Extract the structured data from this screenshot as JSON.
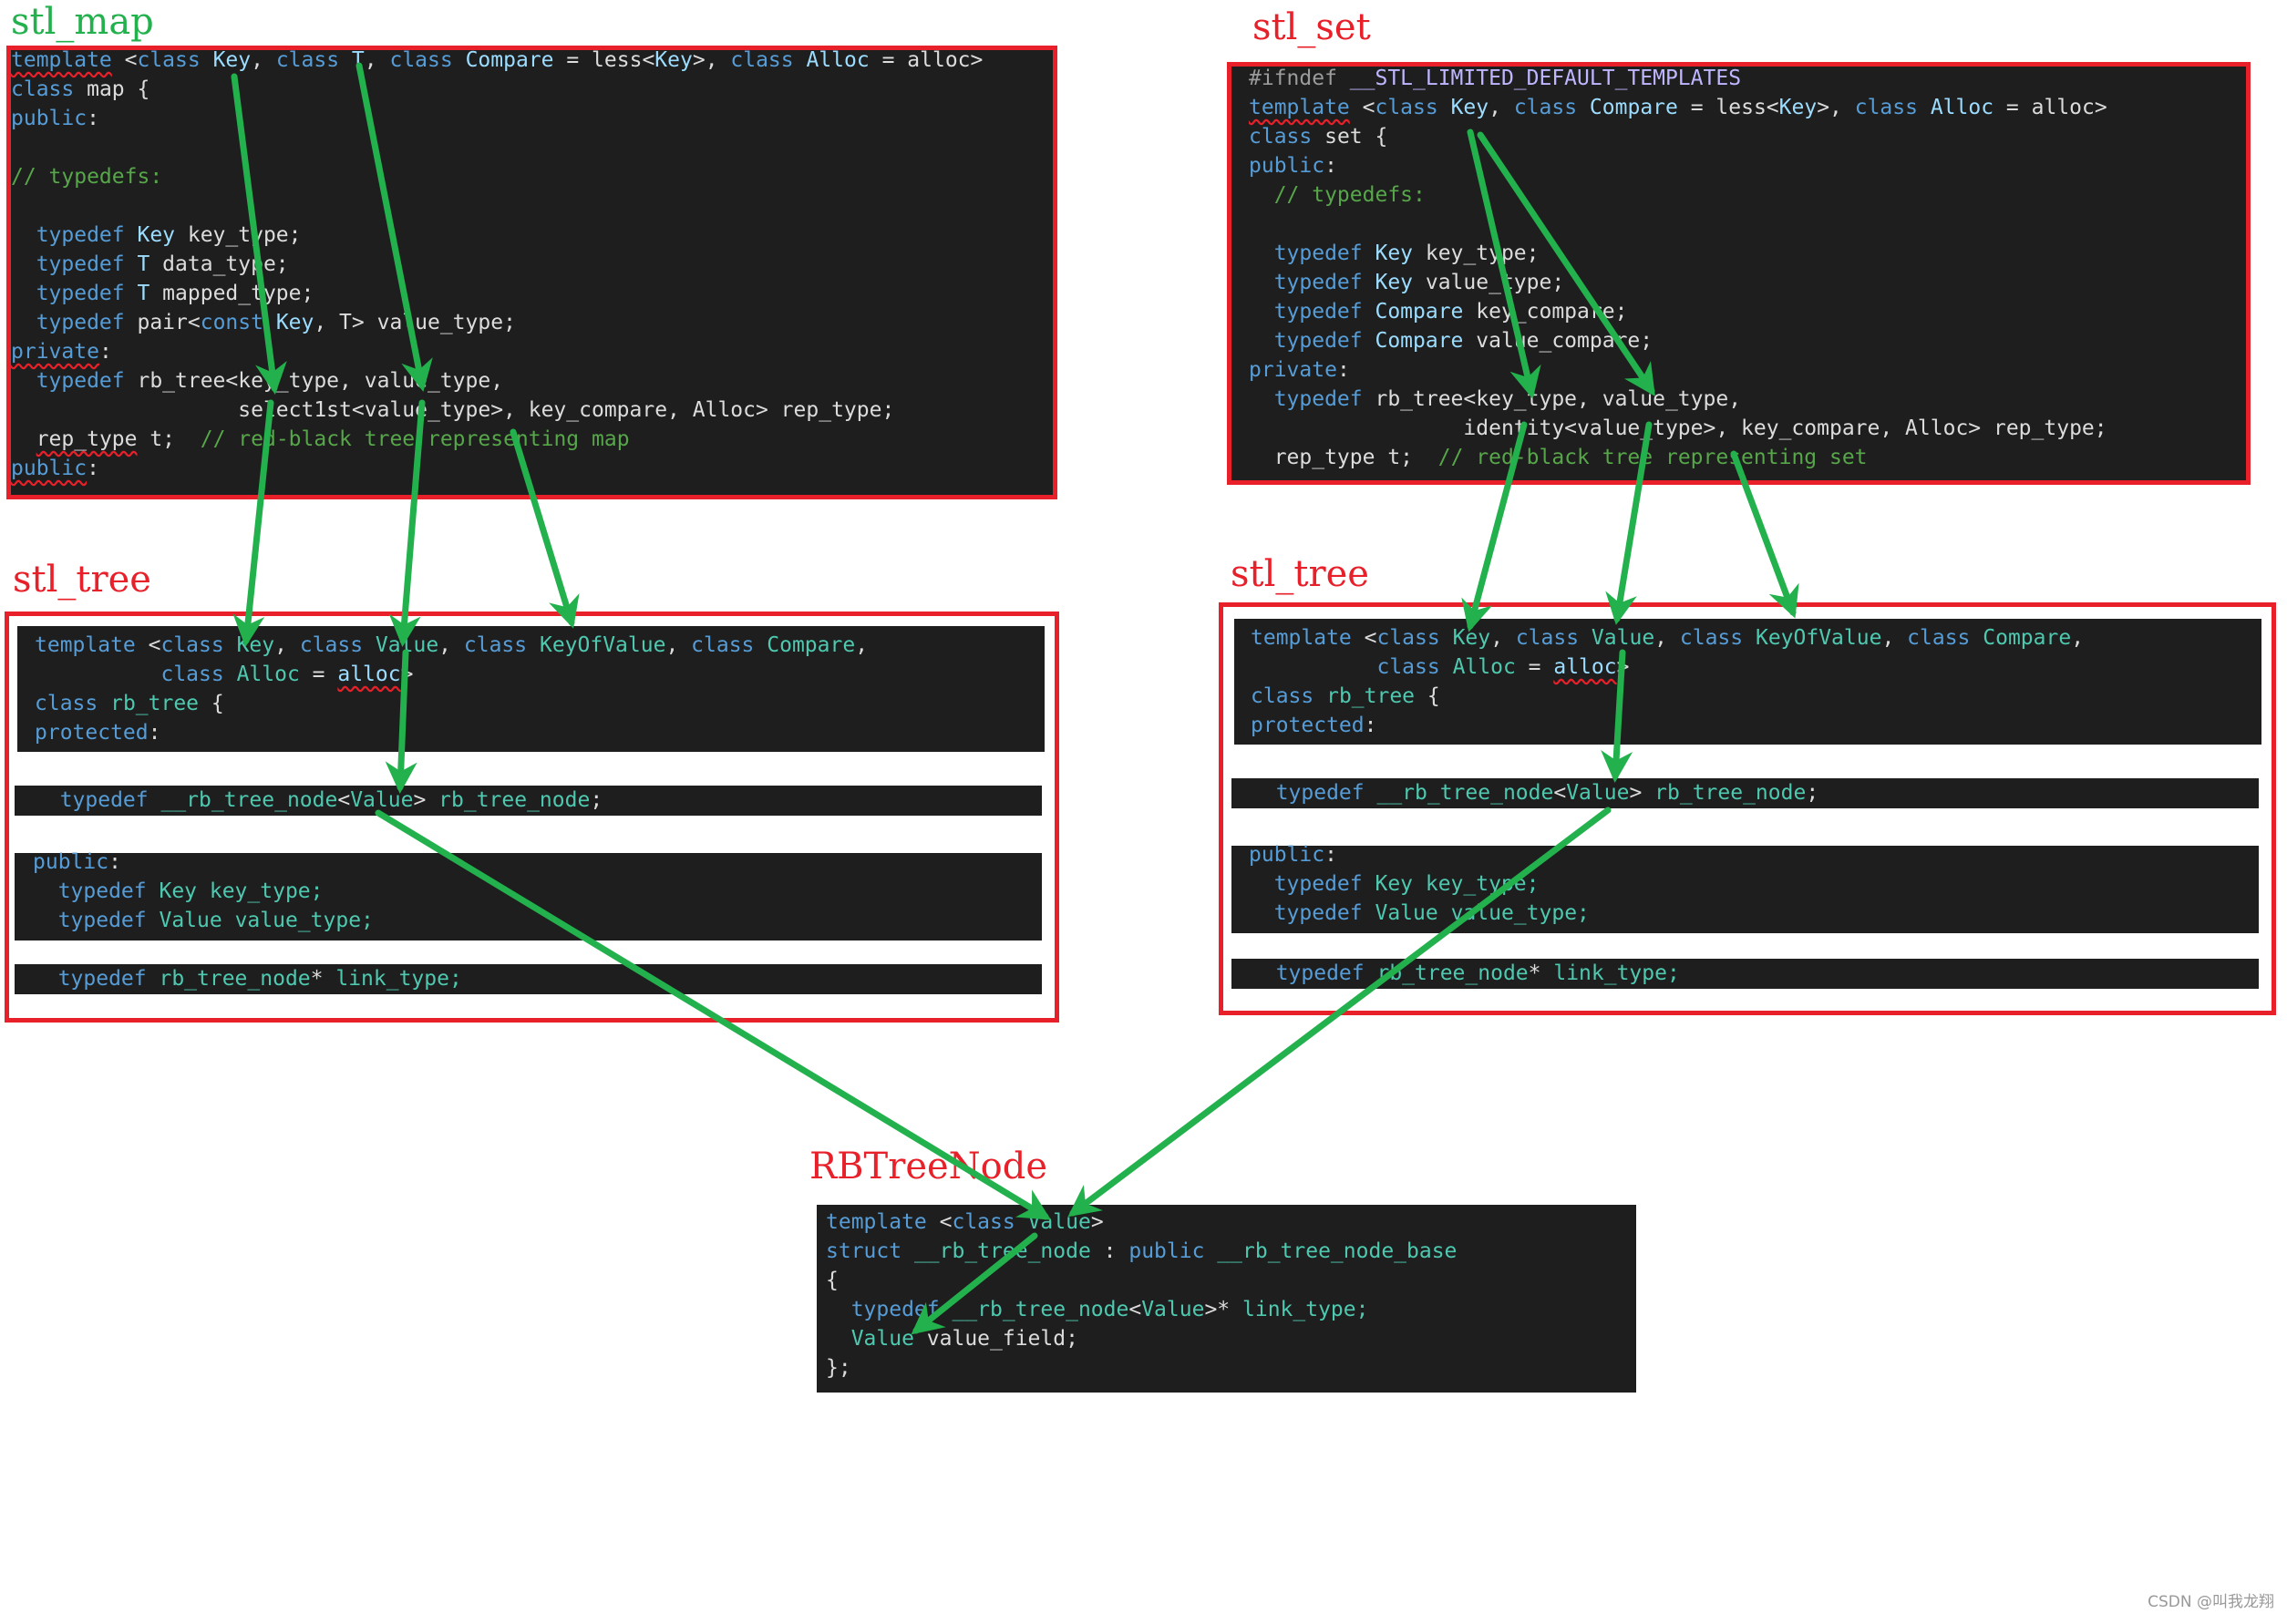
{
  "colors": {
    "arrow": "#22b14c",
    "box_border": "#e8202a",
    "map_label": "#22b14c",
    "other_labels": "#e8202a",
    "code_bg": "#1e1e1e"
  },
  "stl_map": {
    "label": "stl_map",
    "lines": [
      [
        {
          "t": "template",
          "c": "kw sq"
        },
        {
          "t": " <",
          "c": "id"
        },
        {
          "t": "class",
          "c": "kw"
        },
        {
          "t": " Key",
          "c": "pa"
        },
        {
          "t": ", ",
          "c": "id"
        },
        {
          "t": "class",
          "c": "kw"
        },
        {
          "t": " T",
          "c": "pa"
        },
        {
          "t": ", ",
          "c": "id"
        },
        {
          "t": "class",
          "c": "kw"
        },
        {
          "t": " Compare",
          "c": "pa"
        },
        {
          "t": " = less<",
          "c": "id"
        },
        {
          "t": "Key",
          "c": "pa"
        },
        {
          "t": ">, ",
          "c": "id"
        },
        {
          "t": "class",
          "c": "kw"
        },
        {
          "t": " Alloc",
          "c": "pa"
        },
        {
          "t": " = alloc>",
          "c": "id"
        }
      ],
      [
        {
          "t": "class",
          "c": "kw"
        },
        {
          "t": " map {",
          "c": "id"
        }
      ],
      [
        {
          "t": "public",
          "c": "kw"
        },
        {
          "t": ":",
          "c": "id"
        }
      ],
      [],
      [
        {
          "t": "// typedefs:",
          "c": "cm"
        }
      ],
      [],
      [
        {
          "t": "  typedef",
          "c": "kw"
        },
        {
          "t": " Key",
          "c": "pa"
        },
        {
          "t": " key_type;",
          "c": "id"
        }
      ],
      [
        {
          "t": "  typedef",
          "c": "kw"
        },
        {
          "t": " T",
          "c": "pa"
        },
        {
          "t": " data_type;",
          "c": "id"
        }
      ],
      [
        {
          "t": "  typedef",
          "c": "kw"
        },
        {
          "t": " T",
          "c": "pa"
        },
        {
          "t": " mapped_type;",
          "c": "id"
        }
      ],
      [
        {
          "t": "  typedef",
          "c": "kw"
        },
        {
          "t": " pair<",
          "c": "id"
        },
        {
          "t": "const",
          "c": "kw"
        },
        {
          "t": " Key",
          "c": "pa"
        },
        {
          "t": ", T> value_type;",
          "c": "id"
        }
      ],
      [
        {
          "t": "private",
          "c": "kw sq"
        },
        {
          "t": ":",
          "c": "id"
        }
      ],
      [
        {
          "t": "  typedef",
          "c": "kw"
        },
        {
          "t": " rb_tree<key_type, value_type,",
          "c": "id"
        }
      ],
      [
        {
          "t": "                  select1st<value_type>, key_compare, Alloc> rep_type;",
          "c": "id"
        }
      ],
      [
        {
          "t": "  ",
          "c": "id"
        },
        {
          "t": "rep_type",
          "c": "id sq"
        },
        {
          "t": " t;  ",
          "c": "id"
        },
        {
          "t": "// red-black tree representing map",
          "c": "cm"
        }
      ],
      [
        {
          "t": "public",
          "c": "kw sq"
        },
        {
          "t": ":",
          "c": "id"
        }
      ]
    ]
  },
  "stl_set": {
    "label": "stl_set",
    "lines": [
      [
        {
          "t": "#ifndef",
          "c": "pp"
        },
        {
          "t": " __STL_LIMITED_DEFAULT_TEMPLATES",
          "c": "mac"
        }
      ],
      [
        {
          "t": "template",
          "c": "kw sq"
        },
        {
          "t": " <",
          "c": "id"
        },
        {
          "t": "class",
          "c": "kw"
        },
        {
          "t": " Key",
          "c": "pa"
        },
        {
          "t": ", ",
          "c": "id"
        },
        {
          "t": "class",
          "c": "kw"
        },
        {
          "t": " Compare",
          "c": "pa"
        },
        {
          "t": " = less<",
          "c": "id"
        },
        {
          "t": "Key",
          "c": "pa"
        },
        {
          "t": ">, ",
          "c": "id"
        },
        {
          "t": "class",
          "c": "kw"
        },
        {
          "t": " Alloc",
          "c": "pa"
        },
        {
          "t": " = alloc>",
          "c": "id"
        }
      ],
      [
        {
          "t": "class",
          "c": "kw"
        },
        {
          "t": " set {",
          "c": "id"
        }
      ],
      [
        {
          "t": "public",
          "c": "kw"
        },
        {
          "t": ":",
          "c": "id"
        }
      ],
      [
        {
          "t": "  // typedefs:",
          "c": "cm"
        }
      ],
      [],
      [
        {
          "t": "  typedef",
          "c": "kw"
        },
        {
          "t": " Key",
          "c": "pa"
        },
        {
          "t": " key_type;",
          "c": "id"
        }
      ],
      [
        {
          "t": "  typedef",
          "c": "kw"
        },
        {
          "t": " Key",
          "c": "pa"
        },
        {
          "t": " value_type;",
          "c": "id"
        }
      ],
      [
        {
          "t": "  typedef",
          "c": "kw"
        },
        {
          "t": " Compare",
          "c": "pa"
        },
        {
          "t": " key_compare;",
          "c": "id"
        }
      ],
      [
        {
          "t": "  typedef",
          "c": "kw"
        },
        {
          "t": " Compare",
          "c": "pa"
        },
        {
          "t": " value_compare;",
          "c": "id"
        }
      ],
      [
        {
          "t": "private",
          "c": "kw"
        },
        {
          "t": ":",
          "c": "id"
        }
      ],
      [
        {
          "t": "  typedef",
          "c": "kw"
        },
        {
          "t": " rb_tree<key_type, value_type,",
          "c": "id"
        }
      ],
      [
        {
          "t": "                 identity<value_type>, key_compare, Alloc> rep_type;",
          "c": "id"
        }
      ],
      [
        {
          "t": "  rep_type t;  ",
          "c": "id"
        },
        {
          "t": "// red-black tree representing set",
          "c": "cm"
        }
      ]
    ]
  },
  "stl_tree": {
    "label": "stl_tree",
    "panels": [
      [
        [
          {
            "t": "template",
            "c": "kw"
          },
          {
            "t": " <",
            "c": "id"
          },
          {
            "t": "class",
            "c": "kw"
          },
          {
            "t": " Key",
            "c": "ty"
          },
          {
            "t": ", ",
            "c": "id"
          },
          {
            "t": "class",
            "c": "kw"
          },
          {
            "t": " Value",
            "c": "ty"
          },
          {
            "t": ", ",
            "c": "id"
          },
          {
            "t": "class",
            "c": "kw"
          },
          {
            "t": " KeyOfValue",
            "c": "ty"
          },
          {
            "t": ", ",
            "c": "id"
          },
          {
            "t": "class",
            "c": "kw"
          },
          {
            "t": " Compare",
            "c": "ty"
          },
          {
            "t": ",",
            "c": "id"
          }
        ],
        [
          {
            "t": "          class",
            "c": "kw"
          },
          {
            "t": " Alloc",
            "c": "ty"
          },
          {
            "t": " = ",
            "c": "id"
          },
          {
            "t": "alloc",
            "c": "pa sq"
          },
          {
            "t": ">",
            "c": "id"
          }
        ],
        [
          {
            "t": "class",
            "c": "kw"
          },
          {
            "t": " rb_tree",
            "c": "ty"
          },
          {
            "t": " {",
            "c": "id"
          }
        ],
        [
          {
            "t": "protected",
            "c": "kw"
          },
          {
            "t": ":",
            "c": "id"
          }
        ]
      ],
      [
        [
          {
            "t": "  typedef",
            "c": "kw"
          },
          {
            "t": " __rb_tree_node",
            "c": "ty"
          },
          {
            "t": "<",
            "c": "id"
          },
          {
            "t": "Value",
            "c": "ty"
          },
          {
            "t": "> ",
            "c": "id"
          },
          {
            "t": "rb_tree_node",
            "c": "ty"
          },
          {
            "t": ";",
            "c": "id"
          }
        ]
      ],
      [
        [
          {
            "t": "public",
            "c": "kw"
          },
          {
            "t": ":",
            "c": "id"
          }
        ],
        [
          {
            "t": "  typedef",
            "c": "kw"
          },
          {
            "t": " Key",
            "c": "ty"
          },
          {
            "t": " key_type;",
            "c": "ty"
          }
        ],
        [
          {
            "t": "  typedef",
            "c": "kw"
          },
          {
            "t": " Value",
            "c": "ty"
          },
          {
            "t": " value_type;",
            "c": "ty"
          }
        ]
      ],
      [
        [
          {
            "t": "  typedef",
            "c": "kw"
          },
          {
            "t": " rb_tree_node",
            "c": "ty"
          },
          {
            "t": "* ",
            "c": "id"
          },
          {
            "t": "link_type;",
            "c": "ty"
          }
        ]
      ]
    ]
  },
  "rb_tree_node": {
    "label": "RBTreeNode",
    "lines": [
      [
        {
          "t": "template",
          "c": "kw"
        },
        {
          "t": " <",
          "c": "id"
        },
        {
          "t": "class",
          "c": "kw"
        },
        {
          "t": " Value",
          "c": "ty"
        },
        {
          "t": ">",
          "c": "id"
        }
      ],
      [
        {
          "t": "struct",
          "c": "kw"
        },
        {
          "t": " __rb_tree_node",
          "c": "ty"
        },
        {
          "t": " : ",
          "c": "id"
        },
        {
          "t": "public",
          "c": "kw"
        },
        {
          "t": " __rb_tree_node_base",
          "c": "ty"
        }
      ],
      [
        {
          "t": "{",
          "c": "id"
        }
      ],
      [
        {
          "t": "  typedef",
          "c": "kw"
        },
        {
          "t": " __rb_tree_node",
          "c": "ty"
        },
        {
          "t": "<",
          "c": "id"
        },
        {
          "t": "Value",
          "c": "ty"
        },
        {
          "t": ">* ",
          "c": "id"
        },
        {
          "t": "link_type;",
          "c": "ty"
        }
      ],
      [
        {
          "t": "  Value",
          "c": "ty"
        },
        {
          "t": " value_field;",
          "c": "id"
        }
      ],
      [
        {
          "t": "};",
          "c": "id"
        }
      ]
    ]
  },
  "arrows": [
    {
      "from": "map.template.Key",
      "to": "map.rb_tree.key_type"
    },
    {
      "from": "map.template.T",
      "to": "map.rb_tree.value_type"
    },
    {
      "from": "map.rb_tree.key_type",
      "to": "tree_left.template.Key"
    },
    {
      "from": "map.rb_tree.value_type",
      "to": "tree_left.template.Value"
    },
    {
      "from": "map.select1st",
      "to": "tree_left.template.KeyOfValue"
    },
    {
      "from": "tree_left.template.Value",
      "to": "tree_left.rb_tree_node.Value"
    },
    {
      "from": "tree_left.rb_tree_node.Value",
      "to": "rbtreenode.template.Value"
    },
    {
      "from": "set.template.Key",
      "to": "set.rb_tree.key_type"
    },
    {
      "from": "set.template.Key",
      "to": "set.rb_tree.value_type"
    },
    {
      "from": "set.rb_tree.key_type",
      "to": "tree_right.template.Key"
    },
    {
      "from": "set.rb_tree.value_type",
      "to": "tree_right.template.Value"
    },
    {
      "from": "set.identity",
      "to": "tree_right.template.KeyOfValue"
    },
    {
      "from": "tree_right.template.Value",
      "to": "tree_right.rb_tree_node.Value"
    },
    {
      "from": "tree_right.rb_tree_node.Value",
      "to": "rbtreenode.template.Value"
    },
    {
      "from": "rbtreenode.template.Value",
      "to": "rbtreenode.value_field.Value"
    }
  ],
  "watermark": "CSDN @叫我龙翔"
}
